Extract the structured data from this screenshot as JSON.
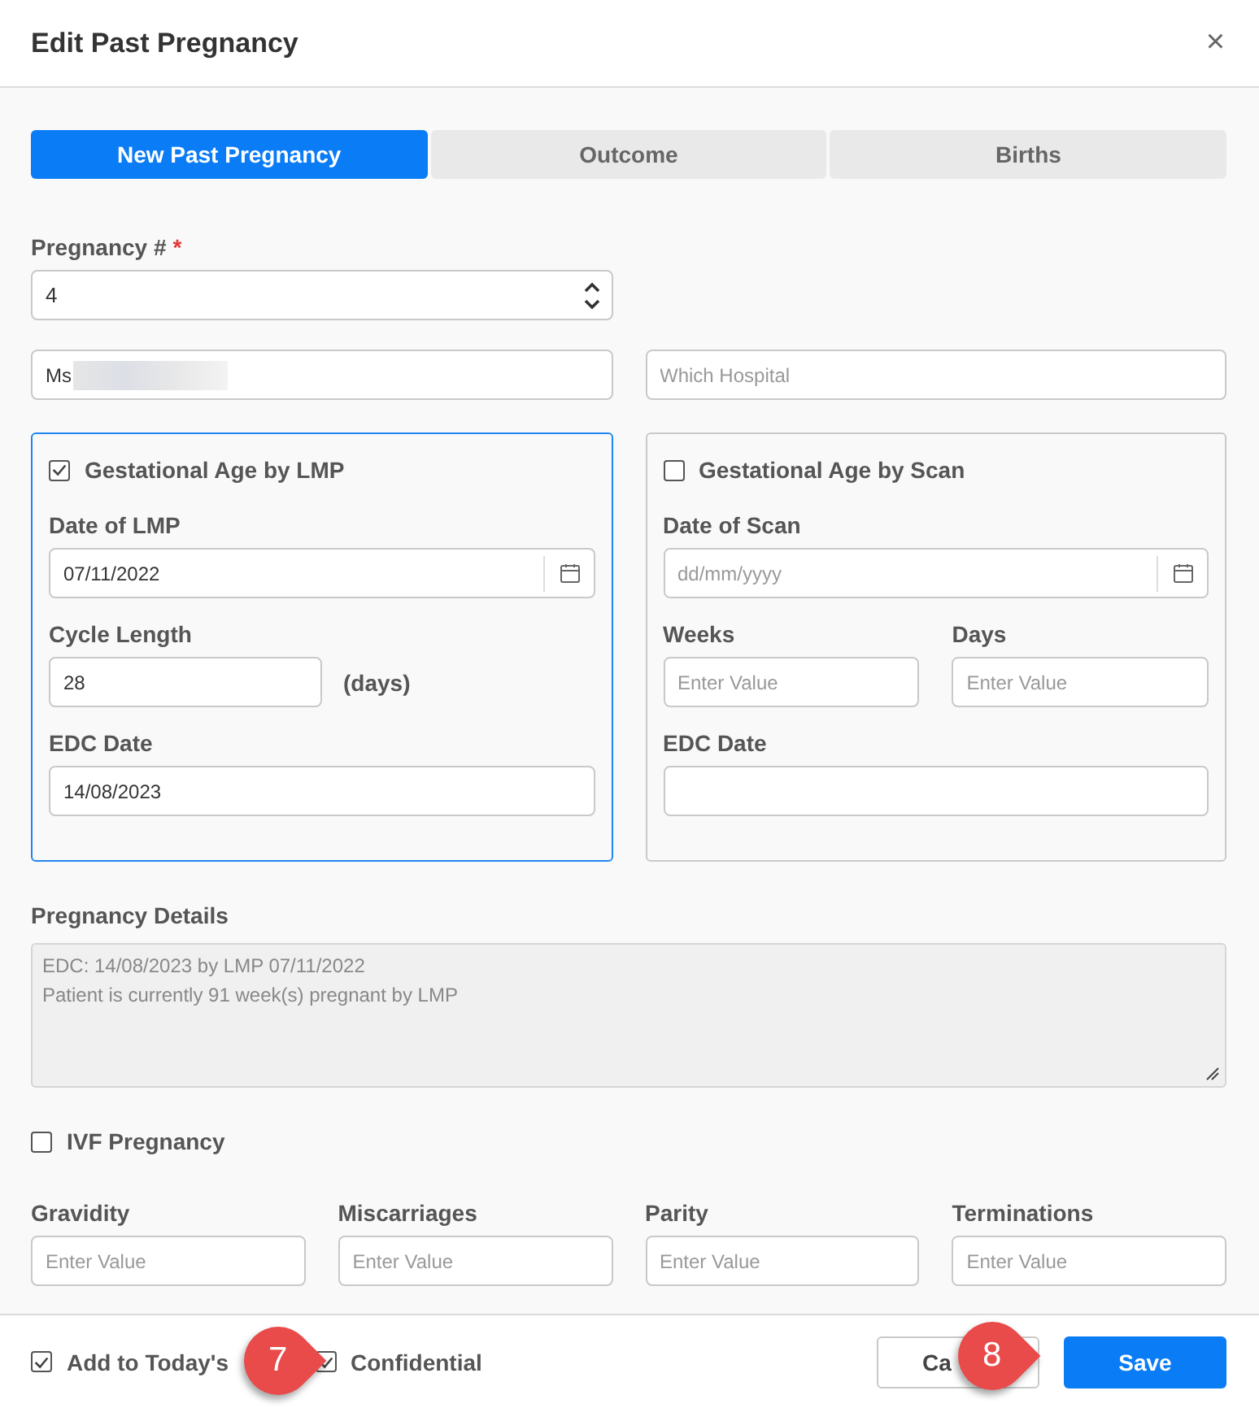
{
  "dialog": {
    "title": "Edit Past Pregnancy",
    "close": "×"
  },
  "tabs": [
    {
      "label": "New Past Pregnancy",
      "selected": true
    },
    {
      "label": "Outcome",
      "selected": false
    },
    {
      "label": "Births",
      "selected": false
    }
  ],
  "pregnancy_number": {
    "label": "Pregnancy #",
    "required": true,
    "required_mark": "*",
    "value": "4"
  },
  "patient_name": {
    "value": "Ms"
  },
  "hospital": {
    "placeholder": "Which Hospital"
  },
  "gestation_panels": [
    {
      "title": "Gestational Age by LMP",
      "checked": true,
      "selected": true,
      "fields": [
        {
          "kind": "date",
          "label": "Date of LMP",
          "value": "07/11/2022"
        },
        {
          "kind": "number",
          "label": "Cycle Length",
          "value": "28",
          "unit": "(days)"
        },
        {
          "kind": "text",
          "label": "EDC Date",
          "value": "14/08/2023"
        }
      ]
    },
    {
      "title": "Gestational Age by Scan",
      "checked": false,
      "selected": false,
      "fields": [
        {
          "kind": "date",
          "label": "Date of Scan",
          "placeholder": "dd/mm/yyyy"
        },
        {
          "kind": "pair",
          "parts": [
            {
              "label": "Weeks",
              "placeholder": "Enter Value"
            },
            {
              "label": "Days",
              "placeholder": "Enter Value"
            }
          ]
        },
        {
          "kind": "text",
          "label": "EDC Date"
        }
      ]
    }
  ],
  "pregnancy_details": {
    "label": "Pregnancy Details",
    "lines": [
      "EDC: 14/08/2023 by LMP 07/11/2022",
      "Patient is currently 91 week(s) pregnant by LMP"
    ]
  },
  "ivf": {
    "label": "IVF Pregnancy",
    "checked": false
  },
  "counts": [
    {
      "label": "Gravidity",
      "placeholder": "Enter Value"
    },
    {
      "label": "Miscarriages",
      "placeholder": "Enter Value"
    },
    {
      "label": "Parity",
      "placeholder": "Enter Value"
    },
    {
      "label": "Terminations",
      "placeholder": "Enter Value"
    }
  ],
  "footer": {
    "checkboxes": [
      {
        "label": "Add to Today's",
        "checked": true
      },
      {
        "label": "Confidential",
        "checked": true
      }
    ],
    "buttons": [
      {
        "label": "Ca",
        "kind": "secondary"
      },
      {
        "label": "Save",
        "kind": "primary"
      }
    ],
    "callouts": [
      "7",
      "8"
    ]
  }
}
